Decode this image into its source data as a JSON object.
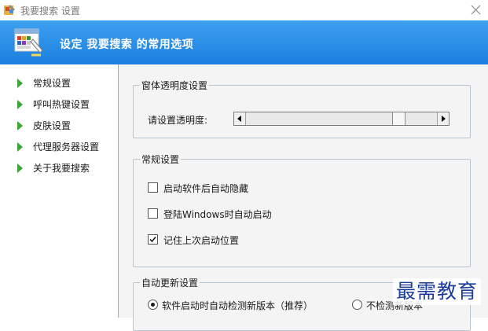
{
  "window": {
    "title": "我要搜索 设置",
    "close_icon": "close-icon"
  },
  "banner": {
    "title": "设定 我要搜索 的常用选项",
    "icon": "settings-palette-icon"
  },
  "sidebar": {
    "items": [
      {
        "label": "常规设置"
      },
      {
        "label": "呼叫热键设置"
      },
      {
        "label": "皮肤设置"
      },
      {
        "label": "代理服务器设置"
      },
      {
        "label": "关于我要搜索"
      }
    ],
    "arrow_color": "#3aa635"
  },
  "transparency": {
    "legend": "窗体透明度设置",
    "label": "请设置透明度:",
    "value": 0.82
  },
  "general": {
    "legend": "常规设置",
    "options": [
      {
        "label": "启动软件后自动隐藏",
        "checked": false
      },
      {
        "label": "登陆Windows时自动启动",
        "checked": false
      },
      {
        "label": "记住上次启动位置",
        "checked": true
      }
    ]
  },
  "update": {
    "legend": "自动更新设置",
    "options": [
      {
        "label": "软件启动时自动检测新版本（推荐）",
        "selected": true
      },
      {
        "label": "不检测新版本",
        "selected": false
      }
    ]
  },
  "watermark": "最需教育",
  "colors": {
    "banner_top": "#3da0f0",
    "banner_bottom": "#1c7fdf",
    "content_bg": "#f4f4f4",
    "watermark": "#1a3c9c"
  }
}
